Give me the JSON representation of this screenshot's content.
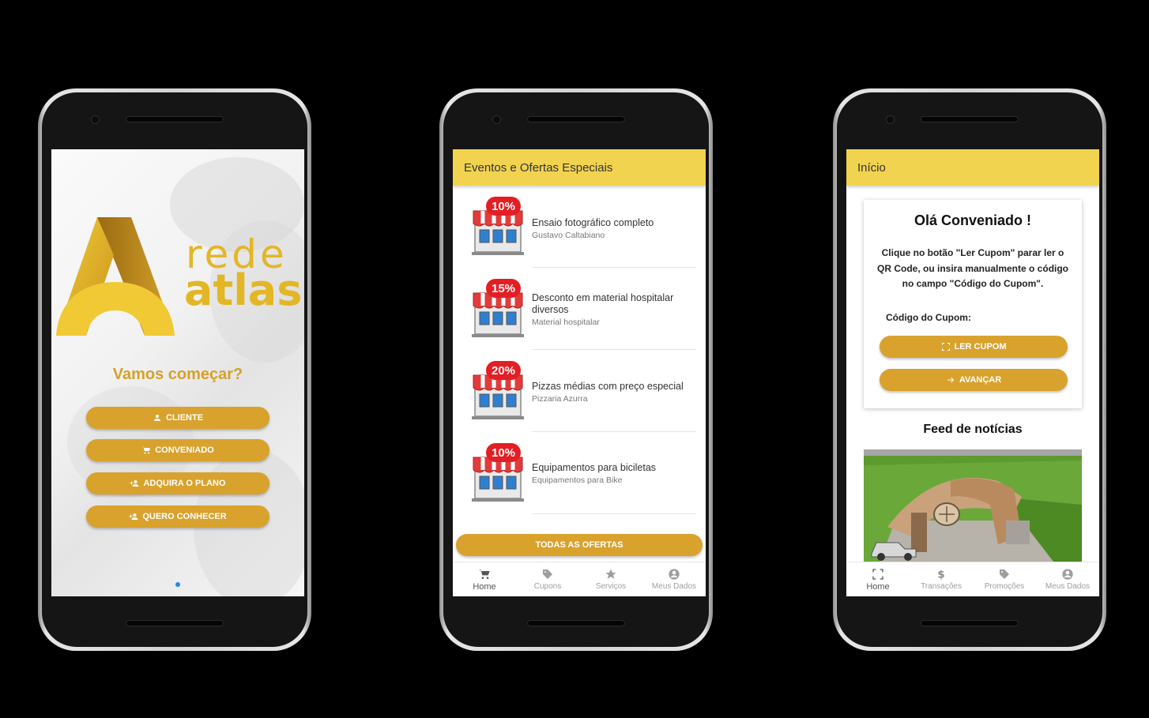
{
  "screens": {
    "welcome": {
      "logo_rede": "rede",
      "logo_atlas": "atlas",
      "title": "Vamos começar?",
      "buttons": [
        {
          "label": "CLIENTE",
          "icon": "person-icon"
        },
        {
          "label": "CONVENIADO",
          "icon": "cart-icon"
        },
        {
          "label": "ADQUIRA O PLANO",
          "icon": "person-add-icon"
        },
        {
          "label": "QUERO CONHECER",
          "icon": "person-add-icon"
        }
      ],
      "page_indicator_color": "#1e88e5"
    },
    "offers": {
      "appbar_title": "Eventos e Ofertas Especiais",
      "offers": [
        {
          "badge": "10%",
          "title": "Ensaio fotográfico completo",
          "subtitle": "Gustavo Caltabiano"
        },
        {
          "badge": "15%",
          "title": "Desconto em material hospitalar diversos",
          "subtitle": "Material hospitalar"
        },
        {
          "badge": "20%",
          "title": "Pizzas médias com preço especial",
          "subtitle": "Pizzaria Azurra"
        },
        {
          "badge": "10%",
          "title": "Equipamentos para biciletas",
          "subtitle": "Equipamentos para Bike"
        }
      ],
      "all_offers_label": "TODAS AS OFERTAS",
      "nav": [
        {
          "label": "Home",
          "icon": "cart-icon",
          "active": true
        },
        {
          "label": "Cupons",
          "icon": "tag-icon",
          "active": false
        },
        {
          "label": "Serviços",
          "icon": "star-icon",
          "active": false
        },
        {
          "label": "Meus Dados",
          "icon": "account-icon",
          "active": false
        }
      ]
    },
    "home": {
      "appbar_title": "Início",
      "card_title": "Olá Conveniado !",
      "card_text": "Clique no botão \"Ler Cupom\" parar ler o QR Code, ou insira manualmente o código no campo \"Código do Cupom\".",
      "coupon_label": "Código do Cupom:",
      "read_coupon_label": "LER CUPOM",
      "next_label": "AVANÇAR",
      "feed_title": "Feed de notícias",
      "nav": [
        {
          "label": "Home",
          "icon": "scan-icon",
          "active": true
        },
        {
          "label": "Transações",
          "icon": "dollar-icon",
          "active": false
        },
        {
          "label": "Promoções",
          "icon": "tag-icon",
          "active": false
        },
        {
          "label": "Meus Dados",
          "icon": "account-icon",
          "active": false
        }
      ]
    }
  },
  "colors": {
    "brand_gold": "#e3b626",
    "button_gold": "#d8a22d",
    "appbar_yellow": "#f2d34f",
    "badge_red": "#e31e24"
  }
}
